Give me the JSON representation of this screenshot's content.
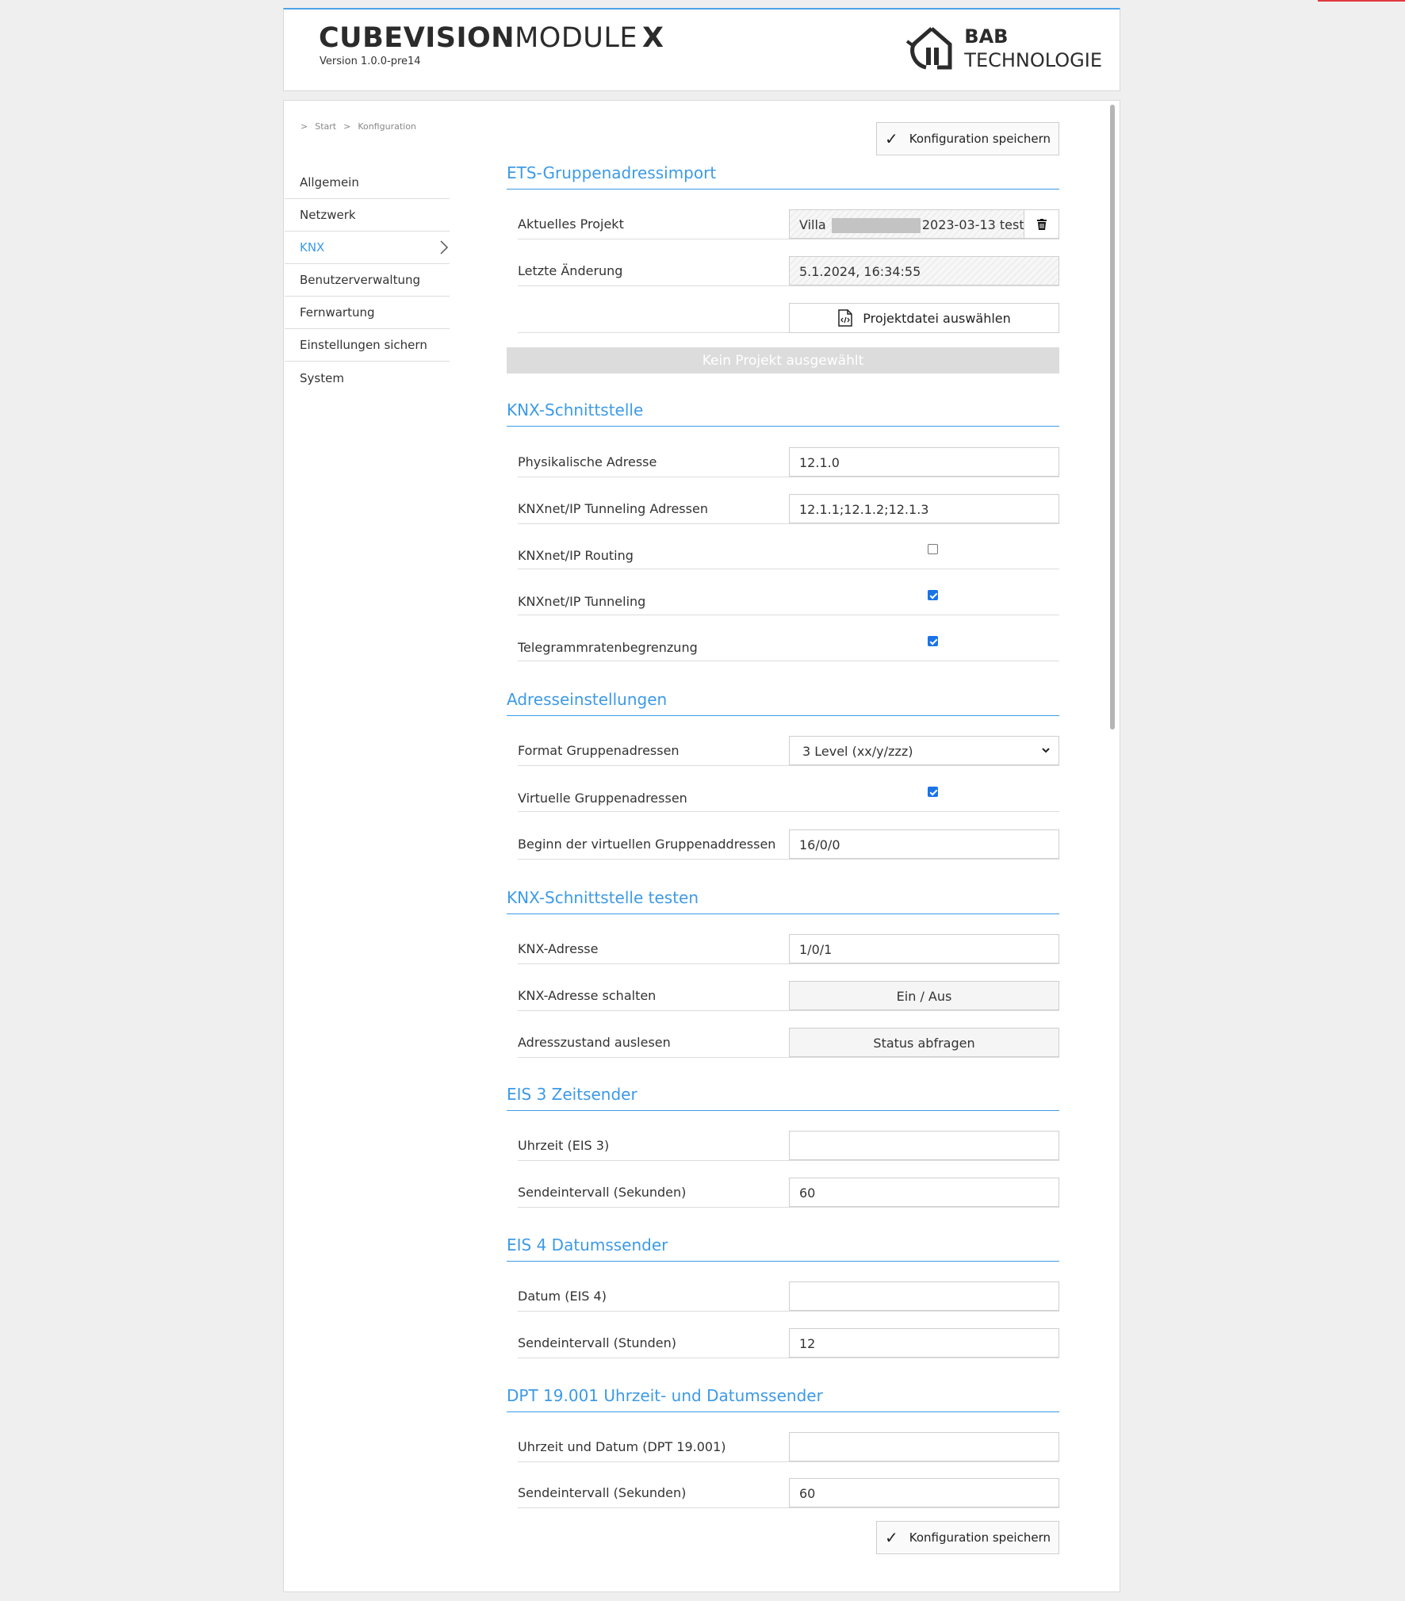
{
  "header": {
    "brand_bold": "CUBEVISION",
    "brand_light": "MODULE",
    "brand_x": "X",
    "version": "Version 1.0.0-pre14",
    "logo_line1": "BAB",
    "logo_line2": "TECHNOLOGIE",
    "logo_icon": "bab-house-refresh-icon"
  },
  "breadcrumb": {
    "sep": ">",
    "items": [
      "Start",
      "Konfiguration"
    ]
  },
  "sidebar": {
    "items": [
      {
        "label": "Allgemein"
      },
      {
        "label": "Netzwerk"
      },
      {
        "label": "KNX",
        "active": true
      },
      {
        "label": "Benutzerverwaltung"
      },
      {
        "label": "Fernwartung"
      },
      {
        "label": "Einstellungen sichern"
      },
      {
        "label": "System"
      }
    ]
  },
  "actions": {
    "save_label": "Konfiguration speichern",
    "save_icon": "check-icon"
  },
  "ets": {
    "title": "ETS-Gruppenadressimport",
    "project_label": "Aktuelles Projekt",
    "project_prefix": "Villa",
    "project_suffix": "2023-03-13 test",
    "last_change_label": "Letzte Änderung",
    "last_change_value": "5.1.2024, 16:34:55",
    "select_file_label": "Projektdatei auswählen",
    "no_project_label": "Kein Projekt ausgewählt"
  },
  "knx_interface": {
    "title": "KNX-Schnittstelle",
    "phys_label": "Physikalische Adresse",
    "phys_value": "12.1.0",
    "tunnel_addr_label": "KNXnet/IP Tunneling Adressen",
    "tunnel_addr_value": "12.1.1;12.1.2;12.1.3",
    "routing_label": "KNXnet/IP Routing",
    "routing_checked": false,
    "tunneling_label": "KNXnet/IP Tunneling",
    "tunneling_checked": true,
    "ratelimit_label": "Telegrammratenbegrenzung",
    "ratelimit_checked": true
  },
  "address_settings": {
    "title": "Adresseinstellungen",
    "format_label": "Format Gruppenadressen",
    "format_value": "3 Level (xx/y/zzz)",
    "virtual_label": "Virtuelle Gruppenadressen",
    "virtual_checked": true,
    "virtual_start_label": "Beginn der virtuellen Gruppenaddressen",
    "virtual_start_value": "16/0/0"
  },
  "test": {
    "title": "KNX-Schnittstelle testen",
    "addr_label": "KNX-Adresse",
    "addr_value": "1/0/1",
    "switch_label": "KNX-Adresse schalten",
    "switch_btn": "Ein / Aus",
    "read_label": "Adresszustand auslesen",
    "read_btn": "Status abfragen"
  },
  "eis3": {
    "title": "EIS 3 Zeitsender",
    "time_label": "Uhrzeit (EIS 3)",
    "time_value": "",
    "interval_label": "Sendeintervall (Sekunden)",
    "interval_value": "60"
  },
  "eis4": {
    "title": "EIS 4 Datumssender",
    "date_label": "Datum (EIS 4)",
    "date_value": "",
    "interval_label": "Sendeintervall (Stunden)",
    "interval_value": "12"
  },
  "dpt": {
    "title": "DPT 19.001 Uhrzeit- und Datumssender",
    "datetime_label": "Uhrzeit und Datum (DPT 19.001)",
    "datetime_value": "",
    "interval_label": "Sendeintervall (Sekunden)",
    "interval_value": "60"
  },
  "colors": {
    "accent": "#3d9ae6",
    "checkbox": "#1a73e8",
    "disabled_btn": "#dcdcdc"
  }
}
